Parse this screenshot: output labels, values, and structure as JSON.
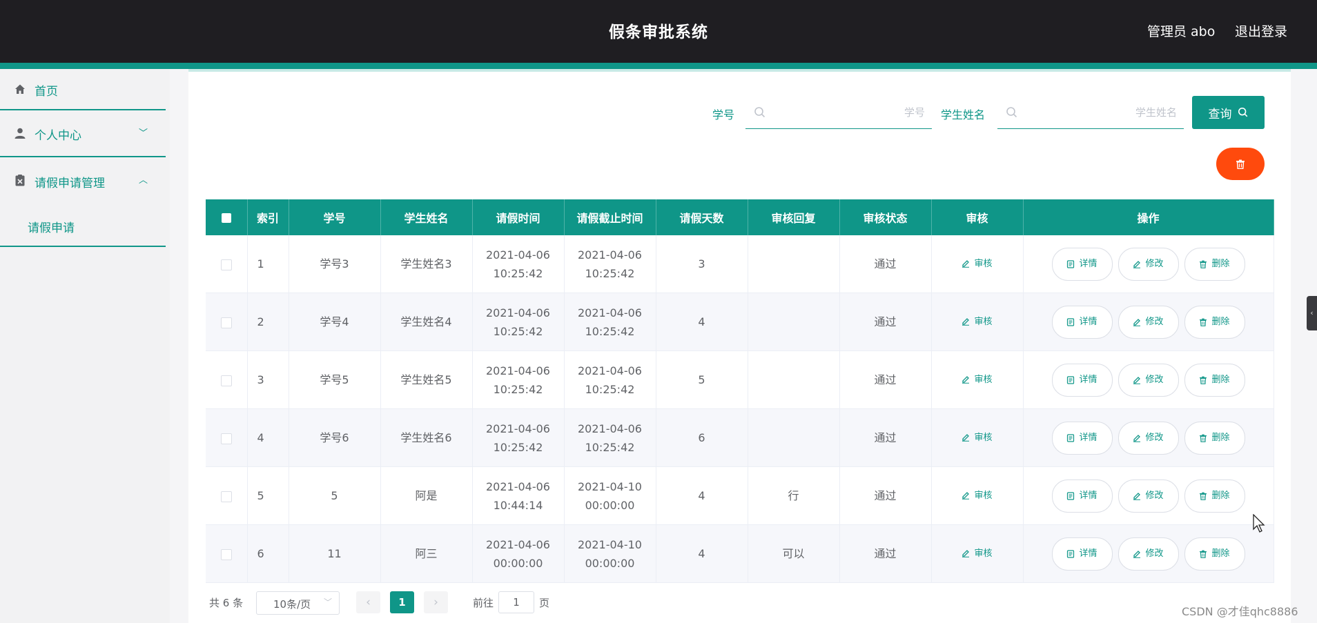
{
  "header": {
    "title": "假条审批系统",
    "admin": "管理员 abo",
    "logout": "退出登录"
  },
  "sidebar": {
    "items": [
      {
        "label": "首页",
        "icon": "home-icon"
      },
      {
        "label": "个人中心",
        "icon": "user-icon",
        "chevron": "﹀"
      },
      {
        "label": "请假申请管理",
        "icon": "clipboard-icon",
        "chevron": "︿"
      }
    ],
    "sub_items": [
      {
        "label": "请假申请"
      }
    ]
  },
  "search": {
    "student_id_label": "学号",
    "student_id_placeholder": "学号",
    "student_name_label": "学生姓名",
    "student_name_placeholder": "学生姓名",
    "query_label": "查询"
  },
  "colors": {
    "accent": "#0f9688",
    "danger": "#ff4a0d",
    "header_bg": "#1f1e22"
  },
  "table": {
    "headers": [
      "索引",
      "学号",
      "学生姓名",
      "请假时间",
      "请假截止时间",
      "请假天数",
      "审核回复",
      "审核状态",
      "审核",
      "操作"
    ],
    "audit_label": "审核",
    "detail_label": "详情",
    "edit_label": "修改",
    "delete_label": "删除",
    "rows": [
      {
        "index": "1",
        "student_id": "学号3",
        "name": "学生姓名3",
        "start_date": "2021-04-06",
        "start_time": "10:25:42",
        "end_date": "2021-04-06",
        "end_time": "10:25:42",
        "days": "3",
        "reply": "",
        "status": "通过"
      },
      {
        "index": "2",
        "student_id": "学号4",
        "name": "学生姓名4",
        "start_date": "2021-04-06",
        "start_time": "10:25:42",
        "end_date": "2021-04-06",
        "end_time": "10:25:42",
        "days": "4",
        "reply": "",
        "status": "通过"
      },
      {
        "index": "3",
        "student_id": "学号5",
        "name": "学生姓名5",
        "start_date": "2021-04-06",
        "start_time": "10:25:42",
        "end_date": "2021-04-06",
        "end_time": "10:25:42",
        "days": "5",
        "reply": "",
        "status": "通过"
      },
      {
        "index": "4",
        "student_id": "学号6",
        "name": "学生姓名6",
        "start_date": "2021-04-06",
        "start_time": "10:25:42",
        "end_date": "2021-04-06",
        "end_time": "10:25:42",
        "days": "6",
        "reply": "",
        "status": "通过"
      },
      {
        "index": "5",
        "student_id": "5",
        "name": "阿是",
        "start_date": "2021-04-06",
        "start_time": "10:44:14",
        "end_date": "2021-04-10",
        "end_time": "00:00:00",
        "days": "4",
        "reply": "行",
        "status": "通过"
      },
      {
        "index": "6",
        "student_id": "11",
        "name": "阿三",
        "start_date": "2021-04-06",
        "start_time": "00:00:00",
        "end_date": "2021-04-10",
        "end_time": "00:00:00",
        "days": "4",
        "reply": "可以",
        "status": "通过"
      }
    ]
  },
  "pagination": {
    "total": "共 6 条",
    "page_size": "10条/页",
    "current": "1",
    "prev": "‹",
    "next": "›",
    "goto_label": "前往",
    "goto_value": "1",
    "unit": "页"
  },
  "watermark": "CSDN @才佳qhc8886"
}
